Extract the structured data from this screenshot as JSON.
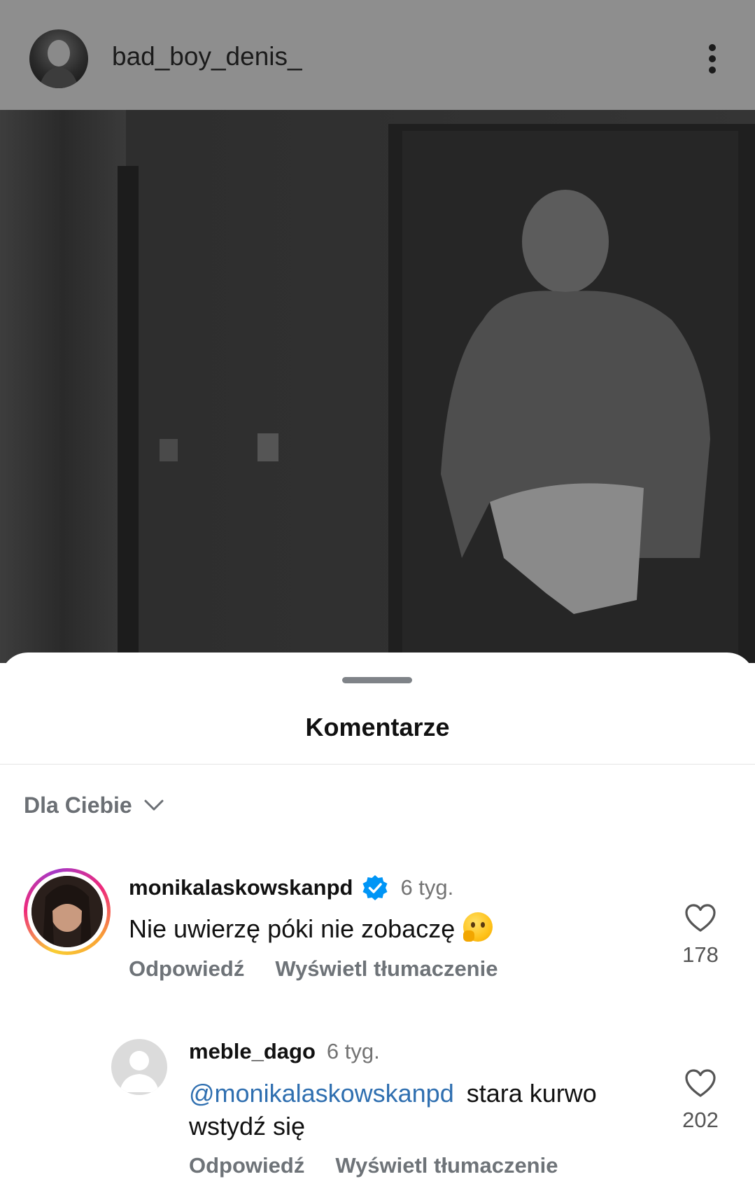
{
  "post": {
    "username": "bad_boy_denis_",
    "avatar_icon": "profile-avatar",
    "menu_icon": "more-vertical-icon"
  },
  "sheet": {
    "title": "Komentarze",
    "sort_label": "Dla Ciebie"
  },
  "comments": [
    {
      "username": "monikalaskowskanpd",
      "verified": true,
      "time": "6 tyg.",
      "text": "Nie uwierzę póki nie zobaczę",
      "emoji": "thinking-face",
      "reply_label": "Odpowiedź",
      "translate_label": "Wyświetl tłumaczenie",
      "likes": "178"
    },
    {
      "username": "meble_dago",
      "verified": false,
      "time": "6 tyg.",
      "mention": "@monikalaskowskanpd",
      "text": "stara kurwo wstydź się",
      "reply_label": "Odpowiedź",
      "translate_label": "Wyświetl tłumaczenie",
      "likes": "202"
    }
  ],
  "colors": {
    "accent_verified": "#0095f6",
    "mention": "#2f6fb0",
    "dim_overlay": "#8e8e8e"
  }
}
